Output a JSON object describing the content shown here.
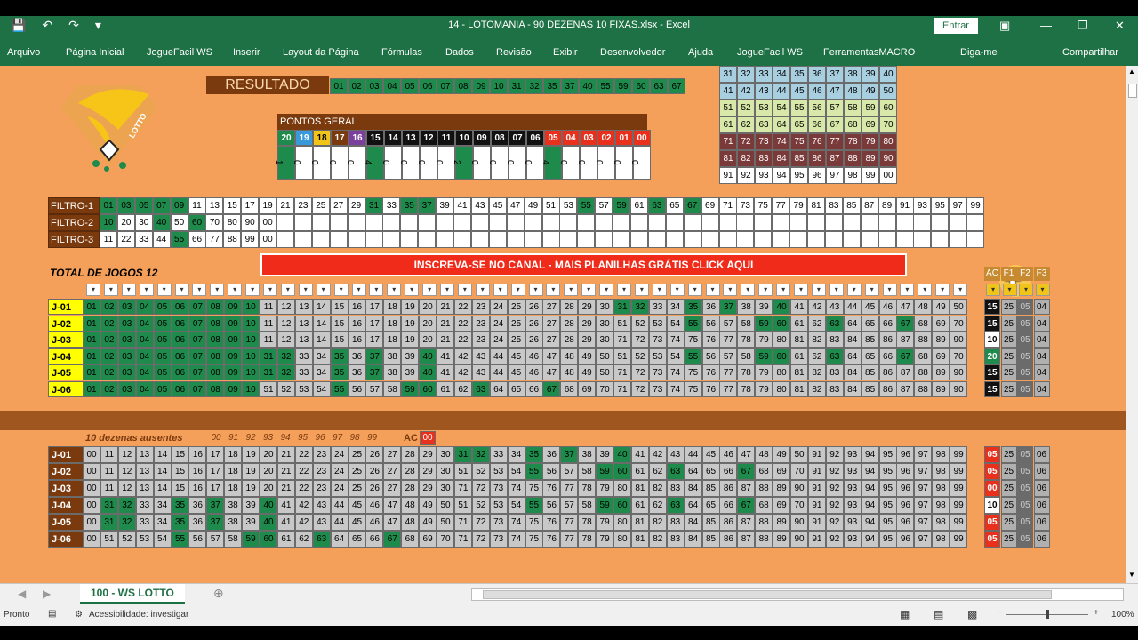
{
  "title": "14 - LOTOMANIA - 90 DEZENAS 10 FIXAS.xlsx  -  Excel",
  "entrar": "Entrar",
  "ribbon_tabs": [
    "Arquivo",
    "Página Inicial",
    "JogueFacil WS",
    "Inserir",
    "Layout da Página",
    "Fórmulas",
    "Dados",
    "Revisão",
    "Exibir",
    "Desenvolvedor",
    "Ajuda",
    "JogueFacil WS",
    "FerramentasMACRO",
    "Diga-me",
    "Compartilhar"
  ],
  "resultado": {
    "label": "RESULTADO",
    "numbers": [
      "01",
      "02",
      "03",
      "04",
      "05",
      "06",
      "07",
      "08",
      "09",
      "10",
      "31",
      "32",
      "35",
      "37",
      "40",
      "55",
      "59",
      "60",
      "63",
      "67"
    ]
  },
  "pontos_geral": {
    "label": "PONTOS GERAL",
    "headers": [
      "20",
      "19",
      "18",
      "17",
      "16",
      "15",
      "14",
      "13",
      "12",
      "11",
      "10",
      "09",
      "08",
      "07",
      "06",
      "05",
      "04",
      "03",
      "02",
      "01",
      "00"
    ],
    "header_colors": [
      "#1e8a4c",
      "#3a9ad9",
      "#f0c419",
      "#7a3a0e",
      "#7b3f9e",
      "#111",
      "#111",
      "#111",
      "#111",
      "#111",
      "#111",
      "#111",
      "#111",
      "#111",
      "#111",
      "#e8301c",
      "#e8301c",
      "#e8301c",
      "#e8301c",
      "#e8301c",
      "#e8301c"
    ],
    "values": [
      "1",
      "0",
      "0",
      "0",
      "0",
      "4",
      "0",
      "0",
      "0",
      "0",
      "2",
      "0",
      "0",
      "0",
      "0",
      "4",
      "0",
      "0",
      "0",
      "0",
      "0"
    ]
  },
  "grid_top": [
    [
      "31",
      "32",
      "33",
      "34",
      "35",
      "36",
      "37",
      "38",
      "39",
      "40"
    ],
    [
      "41",
      "42",
      "43",
      "44",
      "45",
      "46",
      "47",
      "48",
      "49",
      "50"
    ],
    [
      "51",
      "52",
      "53",
      "54",
      "55",
      "56",
      "57",
      "58",
      "59",
      "60"
    ],
    [
      "61",
      "62",
      "63",
      "64",
      "65",
      "66",
      "67",
      "68",
      "69",
      "70"
    ],
    [
      "71",
      "72",
      "73",
      "74",
      "75",
      "76",
      "77",
      "78",
      "79",
      "80"
    ],
    [
      "81",
      "82",
      "83",
      "84",
      "85",
      "86",
      "87",
      "88",
      "89",
      "90"
    ],
    [
      "91",
      "92",
      "93",
      "94",
      "95",
      "96",
      "97",
      "98",
      "99",
      "00"
    ]
  ],
  "grid_top_colors": [
    "#a8cfe0",
    "#a8cfe0",
    "#d8e8a8",
    "#d8e8a8",
    "#7a3a3a",
    "#7a3a3a",
    "#ffffff"
  ],
  "filtros": [
    {
      "label": "FILTRO-1",
      "values": [
        "01",
        "03",
        "05",
        "07",
        "09",
        "11",
        "13",
        "15",
        "17",
        "19",
        "21",
        "23",
        "25",
        "27",
        "29",
        "31",
        "33",
        "35",
        "37",
        "39",
        "41",
        "43",
        "45",
        "47",
        "49",
        "51",
        "53",
        "55",
        "57",
        "59",
        "61",
        "63",
        "65",
        "67",
        "69",
        "71",
        "73",
        "75",
        "77",
        "79",
        "81",
        "83",
        "85",
        "87",
        "89",
        "91",
        "93",
        "95",
        "97",
        "99"
      ],
      "green": [
        "01",
        "03",
        "05",
        "07",
        "09",
        "31",
        "35",
        "37",
        "55",
        "59",
        "63",
        "67"
      ]
    },
    {
      "label": "FILTRO-2",
      "values": [
        "10",
        "20",
        "30",
        "40",
        "50",
        "60",
        "70",
        "80",
        "90",
        "00"
      ],
      "green": [
        "10",
        "40",
        "60"
      ]
    },
    {
      "label": "FILTRO-3",
      "values": [
        "11",
        "22",
        "33",
        "44",
        "55",
        "66",
        "77",
        "88",
        "99",
        "00"
      ],
      "green": [
        "55"
      ]
    }
  ],
  "total_jogos": "TOTAL DE  JOGOS 12",
  "banner": "INSCREVA-SE NO CANAL - MAIS PLANILHAS GRÁTIS CLICK AQUI",
  "top_headers": [
    "AC",
    "F1",
    "F2",
    "F3"
  ],
  "jogos_top": [
    {
      "label": "J-01",
      "nums": [
        "01",
        "02",
        "03",
        "04",
        "05",
        "06",
        "07",
        "08",
        "09",
        "10",
        "11",
        "12",
        "13",
        "14",
        "15",
        "16",
        "17",
        "18",
        "19",
        "20",
        "21",
        "22",
        "23",
        "24",
        "25",
        "26",
        "27",
        "28",
        "29",
        "30",
        "31",
        "32",
        "33",
        "34",
        "35",
        "36",
        "37",
        "38",
        "39",
        "40",
        "41",
        "42",
        "43",
        "44",
        "45",
        "46",
        "47",
        "48",
        "49",
        "50"
      ],
      "stats": [
        "15",
        "25",
        "05",
        "04"
      ]
    },
    {
      "label": "J-02",
      "nums": [
        "01",
        "02",
        "03",
        "04",
        "05",
        "06",
        "07",
        "08",
        "09",
        "10",
        "11",
        "12",
        "13",
        "14",
        "15",
        "16",
        "17",
        "18",
        "19",
        "20",
        "21",
        "22",
        "23",
        "24",
        "25",
        "26",
        "27",
        "28",
        "29",
        "30",
        "51",
        "52",
        "53",
        "54",
        "55",
        "56",
        "57",
        "58",
        "59",
        "60",
        "61",
        "62",
        "63",
        "64",
        "65",
        "66",
        "67",
        "68",
        "69",
        "70"
      ],
      "stats": [
        "15",
        "25",
        "05",
        "04"
      ]
    },
    {
      "label": "J-03",
      "nums": [
        "01",
        "02",
        "03",
        "04",
        "05",
        "06",
        "07",
        "08",
        "09",
        "10",
        "11",
        "12",
        "13",
        "14",
        "15",
        "16",
        "17",
        "18",
        "19",
        "20",
        "21",
        "22",
        "23",
        "24",
        "25",
        "26",
        "27",
        "28",
        "29",
        "30",
        "71",
        "72",
        "73",
        "74",
        "75",
        "76",
        "77",
        "78",
        "79",
        "80",
        "81",
        "82",
        "83",
        "84",
        "85",
        "86",
        "87",
        "88",
        "89",
        "90"
      ],
      "stats": [
        "10",
        "25",
        "05",
        "04"
      ]
    },
    {
      "label": "J-04",
      "nums": [
        "01",
        "02",
        "03",
        "04",
        "05",
        "06",
        "07",
        "08",
        "09",
        "10",
        "31",
        "32",
        "33",
        "34",
        "35",
        "36",
        "37",
        "38",
        "39",
        "40",
        "41",
        "42",
        "43",
        "44",
        "45",
        "46",
        "47",
        "48",
        "49",
        "50",
        "51",
        "52",
        "53",
        "54",
        "55",
        "56",
        "57",
        "58",
        "59",
        "60",
        "61",
        "62",
        "63",
        "64",
        "65",
        "66",
        "67",
        "68",
        "69",
        "70"
      ],
      "stats": [
        "20",
        "25",
        "05",
        "04"
      ]
    },
    {
      "label": "J-05",
      "nums": [
        "01",
        "02",
        "03",
        "04",
        "05",
        "06",
        "07",
        "08",
        "09",
        "10",
        "31",
        "32",
        "33",
        "34",
        "35",
        "36",
        "37",
        "38",
        "39",
        "40",
        "41",
        "42",
        "43",
        "44",
        "45",
        "46",
        "47",
        "48",
        "49",
        "50",
        "71",
        "72",
        "73",
        "74",
        "75",
        "76",
        "77",
        "78",
        "79",
        "80",
        "81",
        "82",
        "83",
        "84",
        "85",
        "86",
        "87",
        "88",
        "89",
        "90"
      ],
      "stats": [
        "15",
        "25",
        "05",
        "04"
      ]
    },
    {
      "label": "J-06",
      "nums": [
        "01",
        "02",
        "03",
        "04",
        "05",
        "06",
        "07",
        "08",
        "09",
        "10",
        "51",
        "52",
        "53",
        "54",
        "55",
        "56",
        "57",
        "58",
        "59",
        "60",
        "61",
        "62",
        "63",
        "64",
        "65",
        "66",
        "67",
        "68",
        "69",
        "70",
        "71",
        "72",
        "73",
        "74",
        "75",
        "76",
        "77",
        "78",
        "79",
        "80",
        "81",
        "82",
        "83",
        "84",
        "85",
        "86",
        "87",
        "88",
        "89",
        "90"
      ],
      "stats": [
        "15",
        "25",
        "05",
        "04"
      ]
    }
  ],
  "top_stat_colors": [
    "#111",
    "#111",
    "#fff",
    "#1e8a4c",
    "#111",
    "#111"
  ],
  "ausentes": {
    "label": "10 dezenas ausentes",
    "numbers": [
      "00",
      "91",
      "92",
      "93",
      "94",
      "95",
      "96",
      "97",
      "98",
      "99"
    ],
    "ac_label": "AC",
    "ac_value": "00"
  },
  "jogos_bottom": [
    {
      "label": "J-01",
      "nums": [
        "00",
        "11",
        "12",
        "13",
        "14",
        "15",
        "16",
        "17",
        "18",
        "19",
        "20",
        "21",
        "22",
        "23",
        "24",
        "25",
        "26",
        "27",
        "28",
        "29",
        "30",
        "31",
        "32",
        "33",
        "34",
        "35",
        "36",
        "37",
        "38",
        "39",
        "40",
        "41",
        "42",
        "43",
        "44",
        "45",
        "46",
        "47",
        "48",
        "49",
        "50",
        "91",
        "92",
        "93",
        "94",
        "95",
        "96",
        "97",
        "98",
        "99"
      ],
      "stats": [
        "05",
        "25",
        "05",
        "06"
      ]
    },
    {
      "label": "J-02",
      "nums": [
        "00",
        "11",
        "12",
        "13",
        "14",
        "15",
        "16",
        "17",
        "18",
        "19",
        "20",
        "21",
        "22",
        "23",
        "24",
        "25",
        "26",
        "27",
        "28",
        "29",
        "30",
        "51",
        "52",
        "53",
        "54",
        "55",
        "56",
        "57",
        "58",
        "59",
        "60",
        "61",
        "62",
        "63",
        "64",
        "65",
        "66",
        "67",
        "68",
        "69",
        "70",
        "91",
        "92",
        "93",
        "94",
        "95",
        "96",
        "97",
        "98",
        "99"
      ],
      "stats": [
        "05",
        "25",
        "05",
        "06"
      ]
    },
    {
      "label": "J-03",
      "nums": [
        "00",
        "11",
        "12",
        "13",
        "14",
        "15",
        "16",
        "17",
        "18",
        "19",
        "20",
        "21",
        "22",
        "23",
        "24",
        "25",
        "26",
        "27",
        "28",
        "29",
        "30",
        "71",
        "72",
        "73",
        "74",
        "75",
        "76",
        "77",
        "78",
        "79",
        "80",
        "81",
        "82",
        "83",
        "84",
        "85",
        "86",
        "87",
        "88",
        "89",
        "90",
        "91",
        "92",
        "93",
        "94",
        "95",
        "96",
        "97",
        "98",
        "99"
      ],
      "stats": [
        "00",
        "25",
        "05",
        "06"
      ]
    },
    {
      "label": "J-04",
      "nums": [
        "00",
        "31",
        "32",
        "33",
        "34",
        "35",
        "36",
        "37",
        "38",
        "39",
        "40",
        "41",
        "42",
        "43",
        "44",
        "45",
        "46",
        "47",
        "48",
        "49",
        "50",
        "51",
        "52",
        "53",
        "54",
        "55",
        "56",
        "57",
        "58",
        "59",
        "60",
        "61",
        "62",
        "63",
        "64",
        "65",
        "66",
        "67",
        "68",
        "69",
        "70",
        "91",
        "92",
        "93",
        "94",
        "95",
        "96",
        "97",
        "98",
        "99"
      ],
      "stats": [
        "10",
        "25",
        "05",
        "06"
      ]
    },
    {
      "label": "J-05",
      "nums": [
        "00",
        "31",
        "32",
        "33",
        "34",
        "35",
        "36",
        "37",
        "38",
        "39",
        "40",
        "41",
        "42",
        "43",
        "44",
        "45",
        "46",
        "47",
        "48",
        "49",
        "50",
        "71",
        "72",
        "73",
        "74",
        "75",
        "76",
        "77",
        "78",
        "79",
        "80",
        "81",
        "82",
        "83",
        "84",
        "85",
        "86",
        "87",
        "88",
        "89",
        "90",
        "91",
        "92",
        "93",
        "94",
        "95",
        "96",
        "97",
        "98",
        "99"
      ],
      "stats": [
        "05",
        "25",
        "05",
        "06"
      ]
    },
    {
      "label": "J-06",
      "nums": [
        "00",
        "51",
        "52",
        "53",
        "54",
        "55",
        "56",
        "57",
        "58",
        "59",
        "60",
        "61",
        "62",
        "63",
        "64",
        "65",
        "66",
        "67",
        "68",
        "69",
        "70",
        "71",
        "72",
        "73",
        "74",
        "75",
        "76",
        "77",
        "78",
        "79",
        "80",
        "81",
        "82",
        "83",
        "84",
        "85",
        "86",
        "87",
        "88",
        "89",
        "90",
        "91",
        "92",
        "93",
        "94",
        "95",
        "96",
        "97",
        "98",
        "99"
      ],
      "stats": [
        "05",
        "25",
        "05",
        "06"
      ]
    }
  ],
  "bottom_stat_colors": [
    "#e8301c",
    "#e8301c",
    "#e8301c",
    "#fff",
    "#e8301c",
    "#e8301c"
  ],
  "hits": [
    "01",
    "02",
    "03",
    "04",
    "05",
    "06",
    "07",
    "08",
    "09",
    "10",
    "31",
    "32",
    "35",
    "37",
    "40",
    "55",
    "59",
    "60",
    "63",
    "67"
  ],
  "sheet_tab": "100 - WS LOTTO",
  "status": {
    "ready": "Pronto",
    "access": "Acessibilidade: investigar",
    "zoom": "100%"
  },
  "colors": {
    "sheet_bg": "#f4a05a",
    "excel_green": "#1e7145",
    "hit_green": "#1e8a4c",
    "dark_brown": "#7a3a0e"
  }
}
